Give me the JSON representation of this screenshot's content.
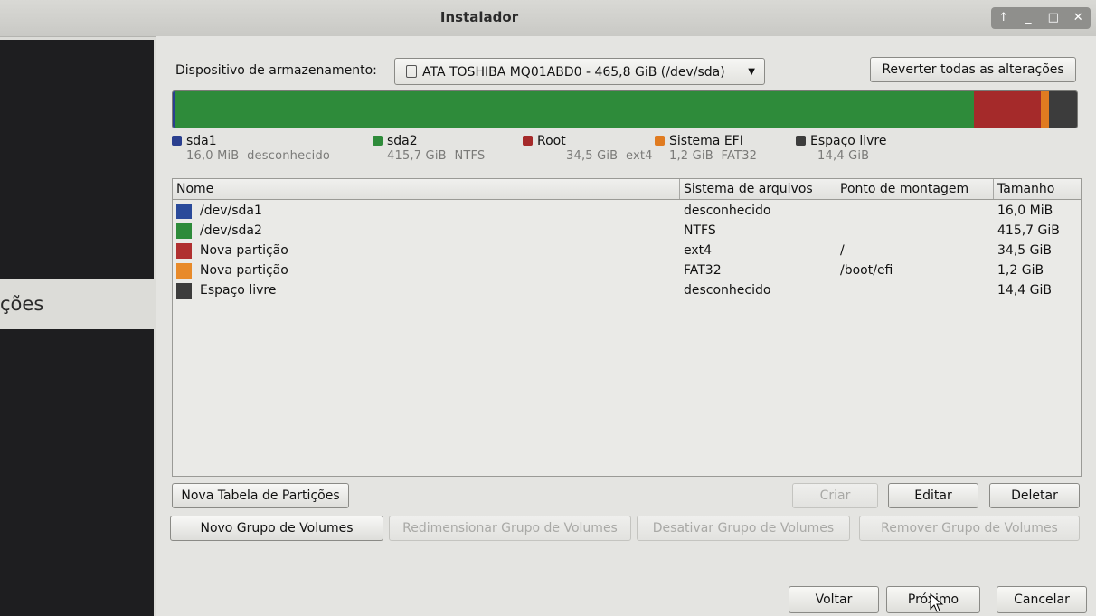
{
  "window": {
    "title": "Instalador",
    "controls": [
      "↑",
      "_",
      "□",
      "✕"
    ]
  },
  "sidebar": {
    "partial_text": "ções"
  },
  "device": {
    "label": "Dispositivo de armazenamento:",
    "selected": "ATA TOSHIBA MQ01ABD0 - 465,8 GiB (/dev/sda)",
    "revert_label": "Reverter todas as alterações"
  },
  "partition_bar": [
    {
      "name": "sda1",
      "color": "#2a3f8f",
      "fraction": 0.003
    },
    {
      "name": "sda2",
      "color": "#2e8b3a",
      "fraction": 0.883
    },
    {
      "name": "Root",
      "color": "#a52a2a",
      "fraction": 0.074
    },
    {
      "name": "Sistema EFI",
      "color": "#e07b20",
      "fraction": 0.009
    },
    {
      "name": "Espaço livre",
      "color": "#3c3c3c",
      "fraction": 0.031
    }
  ],
  "legend": [
    {
      "name": "sda1",
      "size": "16,0 MiB",
      "fs": "desconhecido",
      "color": "#2a3f8f"
    },
    {
      "name": "sda2",
      "size": "415,7 GiB",
      "fs": "NTFS",
      "color": "#2e8b3a"
    },
    {
      "name": "Root",
      "size": "34,5 GiB",
      "fs": "ext4",
      "color": "#a52a2a"
    },
    {
      "name": "Sistema EFI",
      "size": "1,2 GiB",
      "fs": "FAT32",
      "color": "#e07b20"
    },
    {
      "name": "Espaço livre",
      "size": "14,4 GiB",
      "fs": "",
      "color": "#3c3c3c"
    }
  ],
  "table": {
    "headers": [
      "Nome",
      "Sistema de arquivos",
      "Ponto de montagem",
      "Tamanho"
    ],
    "rows": [
      {
        "name": "/dev/sda1",
        "fs": "desconhecido",
        "mount": "",
        "size": "16,0 MiB",
        "color": "#2a4a9a"
      },
      {
        "name": "/dev/sda2",
        "fs": "NTFS",
        "mount": "",
        "size": "415,7 GiB",
        "color": "#2e8b3a"
      },
      {
        "name": "Nova partição",
        "fs": "ext4",
        "mount": "/",
        "size": "34,5 GiB",
        "color": "#b03030"
      },
      {
        "name": "Nova partição",
        "fs": "FAT32",
        "mount": "/boot/efi",
        "size": "1,2 GiB",
        "color": "#e88a2a"
      },
      {
        "name": "Espaço livre",
        "fs": "desconhecido",
        "mount": "",
        "size": "14,4 GiB",
        "color": "#3c3c3c"
      }
    ]
  },
  "buttons": {
    "new_table": "Nova Tabela de Partições",
    "criar": "Criar",
    "editar": "Editar",
    "deletar": "Deletar",
    "new_vg": "Novo Grupo de Volumes",
    "resize_vg": "Redimensionar Grupo de Volumes",
    "deactivate_vg": "Desativar Grupo de Volumes",
    "remove_vg": "Remover Grupo de Volumes",
    "voltar": "Voltar",
    "proximo": "Próximo",
    "cancelar": "Cancelar"
  }
}
